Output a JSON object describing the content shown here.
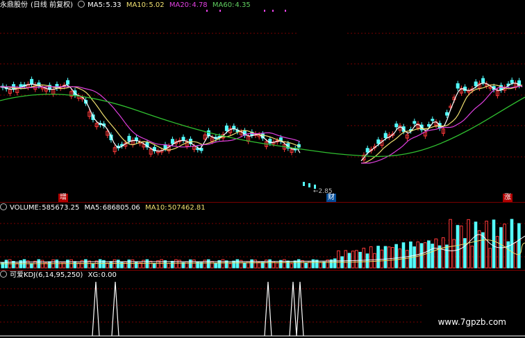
{
  "price_panel": {
    "stock_name": "永鼎股份",
    "period": "(日线 前复权)",
    "indicators": [
      {
        "label": "MA5:",
        "value": "5.33",
        "color": "#ffffff"
      },
      {
        "label": "MA10:",
        "value": "5.02",
        "color": "#f0e070"
      },
      {
        "label": "MA20:",
        "value": "4.78",
        "color": "#e040e0"
      },
      {
        "label": "MA60:",
        "value": "4.35",
        "color": "#60d060"
      }
    ],
    "low_price_label": "2.85",
    "badge_left": "增",
    "badge_mid": "财",
    "badge_right": "涨"
  },
  "volume_panel": {
    "title": "VOLUME:",
    "value": "585673.25",
    "ma5_label": "MA5:",
    "ma5_value": "686805.06",
    "ma10_label": "MA10:",
    "ma10_value": "507462.81"
  },
  "kdj_panel": {
    "title": "可爱KDJ(6,14,95,250)",
    "xg_label": "XG:",
    "xg_value": "0.00"
  },
  "watermark": "www.7gpzb.com",
  "colors": {
    "up": "#ff3a3a",
    "down": "#54ffff",
    "ma5": "#ffffff",
    "ma10": "#f0e070",
    "ma20": "#e040e0",
    "ma60": "#30c030",
    "grid": "#7a0000"
  },
  "chart_data": [
    {
      "type": "candlestick",
      "series": [
        {
          "name": "MA5",
          "value": 5.33
        },
        {
          "name": "MA10",
          "value": 5.02
        },
        {
          "name": "MA20",
          "value": 4.78
        },
        {
          "name": "MA60",
          "value": 4.35
        }
      ],
      "annotations": [
        "2.85"
      ]
    },
    {
      "type": "bar",
      "series": [
        {
          "name": "VOLUME",
          "value": 585673.25
        },
        {
          "name": "MA5",
          "value": 686805.06
        },
        {
          "name": "MA10",
          "value": 507462.81
        }
      ]
    },
    {
      "type": "line",
      "series": [
        {
          "name": "XG",
          "value": 0.0
        }
      ]
    }
  ]
}
